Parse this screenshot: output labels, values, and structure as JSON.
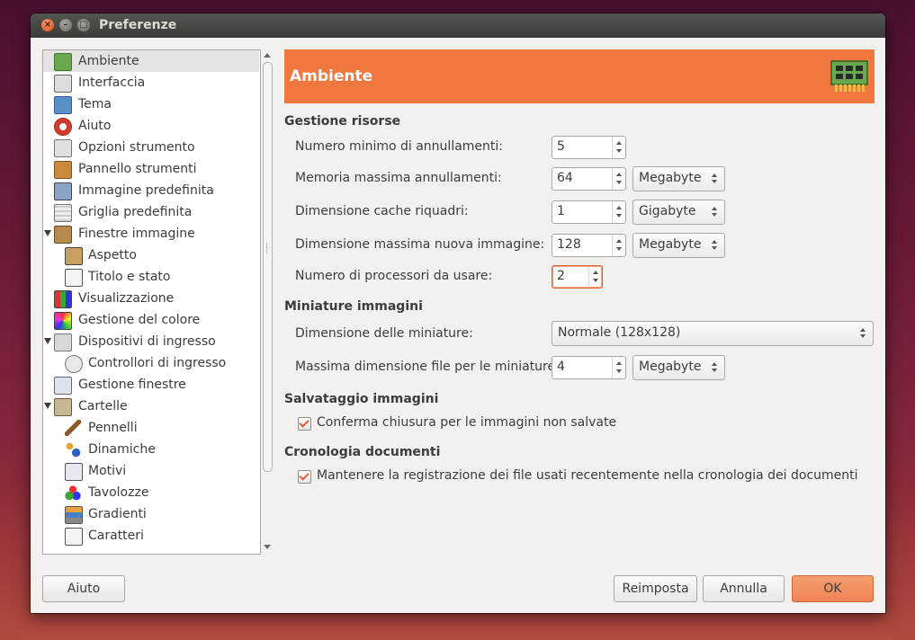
{
  "window": {
    "title": "Preferenze"
  },
  "sidebar": {
    "items": [
      {
        "label": "Ambiente",
        "icon": "environment-icon",
        "selected": true
      },
      {
        "label": "Interfaccia",
        "icon": "interface-icon"
      },
      {
        "label": "Tema",
        "icon": "theme-icon"
      },
      {
        "label": "Aiuto",
        "icon": "help-lifebuoy-icon"
      },
      {
        "label": "Opzioni strumento",
        "icon": "tool-options-icon"
      },
      {
        "label": "Pannello strumenti",
        "icon": "toolbox-icon"
      },
      {
        "label": "Immagine predefinita",
        "icon": "default-image-icon"
      },
      {
        "label": "Griglia predefinita",
        "icon": "default-grid-icon"
      },
      {
        "label": "Finestre immagine",
        "icon": "image-windows-icon",
        "expanded": true
      },
      {
        "label": "Aspetto",
        "icon": "appearance-icon"
      },
      {
        "label": "Titolo e stato",
        "icon": "title-status-icon"
      },
      {
        "label": "Visualizzazione",
        "icon": "display-icon"
      },
      {
        "label": "Gestione del colore",
        "icon": "color-management-icon"
      },
      {
        "label": "Dispositivi di ingresso",
        "icon": "input-devices-icon",
        "expanded": true
      },
      {
        "label": "Controllori di ingresso",
        "icon": "input-controllers-icon"
      },
      {
        "label": "Gestione finestre",
        "icon": "window-management-icon"
      },
      {
        "label": "Cartelle",
        "icon": "folders-icon",
        "expanded": true
      },
      {
        "label": "Pennelli",
        "icon": "brushes-icon"
      },
      {
        "label": "Dinamiche",
        "icon": "dynamics-icon"
      },
      {
        "label": "Motivi",
        "icon": "patterns-icon"
      },
      {
        "label": "Tavolozze",
        "icon": "palettes-icon"
      },
      {
        "label": "Gradienti",
        "icon": "gradients-icon"
      },
      {
        "label": "Caratteri",
        "icon": "fonts-icon"
      }
    ]
  },
  "header": {
    "title": "Ambiente",
    "icon": "memory-chip-icon"
  },
  "sections": {
    "resources": {
      "title": "Gestione risorse",
      "min_undo_label": "Numero minimo di annullamenti:",
      "min_undo_value": "5",
      "max_undo_mem_label": "Memoria massima annullamenti:",
      "max_undo_mem_value": "64",
      "max_undo_mem_unit": "Megabyte",
      "tile_cache_label": "Dimensione cache riquadri:",
      "tile_cache_value": "1",
      "tile_cache_unit": "Gigabyte",
      "max_new_image_label": "Dimensione massima nuova immagine:",
      "max_new_image_value": "128",
      "max_new_image_unit": "Megabyte",
      "processors_label": "Numero di processori da usare:",
      "processors_value": "2"
    },
    "thumbnails": {
      "title": "Miniature immagini",
      "size_label": "Dimensione delle miniature:",
      "size_value": "Normale (128x128)",
      "max_file_label": "Massima dimensione file per le miniature:",
      "max_file_value": "4",
      "max_file_unit": "Megabyte"
    },
    "saving": {
      "title": "Salvataggio immagini",
      "confirm_close_label": "Conferma chiusura per le immagini non salvate",
      "confirm_close_checked": true
    },
    "history": {
      "title": "Cronologia documenti",
      "keep_record_label": "Mantenere la registrazione dei file usati recentemente nella cronologia dei documenti",
      "keep_record_checked": true
    }
  },
  "buttons": {
    "help": "Aiuto",
    "reset": "Reimposta",
    "cancel": "Annulla",
    "ok": "OK"
  },
  "colors": {
    "accent": "#f0773e",
    "titlebar": "#3c3b37",
    "check": "#e35d2f"
  }
}
